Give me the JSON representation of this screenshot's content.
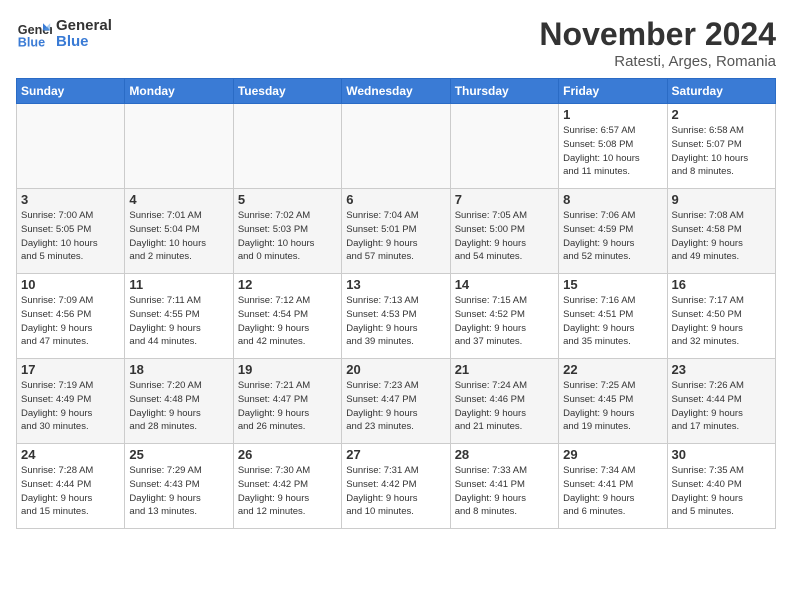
{
  "logo": {
    "line1": "General",
    "line2": "Blue"
  },
  "title": "November 2024",
  "subtitle": "Ratesti, Arges, Romania",
  "days_of_week": [
    "Sunday",
    "Monday",
    "Tuesday",
    "Wednesday",
    "Thursday",
    "Friday",
    "Saturday"
  ],
  "weeks": [
    [
      {
        "day": "",
        "info": ""
      },
      {
        "day": "",
        "info": ""
      },
      {
        "day": "",
        "info": ""
      },
      {
        "day": "",
        "info": ""
      },
      {
        "day": "",
        "info": ""
      },
      {
        "day": "1",
        "info": "Sunrise: 6:57 AM\nSunset: 5:08 PM\nDaylight: 10 hours\nand 11 minutes."
      },
      {
        "day": "2",
        "info": "Sunrise: 6:58 AM\nSunset: 5:07 PM\nDaylight: 10 hours\nand 8 minutes."
      }
    ],
    [
      {
        "day": "3",
        "info": "Sunrise: 7:00 AM\nSunset: 5:05 PM\nDaylight: 10 hours\nand 5 minutes."
      },
      {
        "day": "4",
        "info": "Sunrise: 7:01 AM\nSunset: 5:04 PM\nDaylight: 10 hours\nand 2 minutes."
      },
      {
        "day": "5",
        "info": "Sunrise: 7:02 AM\nSunset: 5:03 PM\nDaylight: 10 hours\nand 0 minutes."
      },
      {
        "day": "6",
        "info": "Sunrise: 7:04 AM\nSunset: 5:01 PM\nDaylight: 9 hours\nand 57 minutes."
      },
      {
        "day": "7",
        "info": "Sunrise: 7:05 AM\nSunset: 5:00 PM\nDaylight: 9 hours\nand 54 minutes."
      },
      {
        "day": "8",
        "info": "Sunrise: 7:06 AM\nSunset: 4:59 PM\nDaylight: 9 hours\nand 52 minutes."
      },
      {
        "day": "9",
        "info": "Sunrise: 7:08 AM\nSunset: 4:58 PM\nDaylight: 9 hours\nand 49 minutes."
      }
    ],
    [
      {
        "day": "10",
        "info": "Sunrise: 7:09 AM\nSunset: 4:56 PM\nDaylight: 9 hours\nand 47 minutes."
      },
      {
        "day": "11",
        "info": "Sunrise: 7:11 AM\nSunset: 4:55 PM\nDaylight: 9 hours\nand 44 minutes."
      },
      {
        "day": "12",
        "info": "Sunrise: 7:12 AM\nSunset: 4:54 PM\nDaylight: 9 hours\nand 42 minutes."
      },
      {
        "day": "13",
        "info": "Sunrise: 7:13 AM\nSunset: 4:53 PM\nDaylight: 9 hours\nand 39 minutes."
      },
      {
        "day": "14",
        "info": "Sunrise: 7:15 AM\nSunset: 4:52 PM\nDaylight: 9 hours\nand 37 minutes."
      },
      {
        "day": "15",
        "info": "Sunrise: 7:16 AM\nSunset: 4:51 PM\nDaylight: 9 hours\nand 35 minutes."
      },
      {
        "day": "16",
        "info": "Sunrise: 7:17 AM\nSunset: 4:50 PM\nDaylight: 9 hours\nand 32 minutes."
      }
    ],
    [
      {
        "day": "17",
        "info": "Sunrise: 7:19 AM\nSunset: 4:49 PM\nDaylight: 9 hours\nand 30 minutes."
      },
      {
        "day": "18",
        "info": "Sunrise: 7:20 AM\nSunset: 4:48 PM\nDaylight: 9 hours\nand 28 minutes."
      },
      {
        "day": "19",
        "info": "Sunrise: 7:21 AM\nSunset: 4:47 PM\nDaylight: 9 hours\nand 26 minutes."
      },
      {
        "day": "20",
        "info": "Sunrise: 7:23 AM\nSunset: 4:47 PM\nDaylight: 9 hours\nand 23 minutes."
      },
      {
        "day": "21",
        "info": "Sunrise: 7:24 AM\nSunset: 4:46 PM\nDaylight: 9 hours\nand 21 minutes."
      },
      {
        "day": "22",
        "info": "Sunrise: 7:25 AM\nSunset: 4:45 PM\nDaylight: 9 hours\nand 19 minutes."
      },
      {
        "day": "23",
        "info": "Sunrise: 7:26 AM\nSunset: 4:44 PM\nDaylight: 9 hours\nand 17 minutes."
      }
    ],
    [
      {
        "day": "24",
        "info": "Sunrise: 7:28 AM\nSunset: 4:44 PM\nDaylight: 9 hours\nand 15 minutes."
      },
      {
        "day": "25",
        "info": "Sunrise: 7:29 AM\nSunset: 4:43 PM\nDaylight: 9 hours\nand 13 minutes."
      },
      {
        "day": "26",
        "info": "Sunrise: 7:30 AM\nSunset: 4:42 PM\nDaylight: 9 hours\nand 12 minutes."
      },
      {
        "day": "27",
        "info": "Sunrise: 7:31 AM\nSunset: 4:42 PM\nDaylight: 9 hours\nand 10 minutes."
      },
      {
        "day": "28",
        "info": "Sunrise: 7:33 AM\nSunset: 4:41 PM\nDaylight: 9 hours\nand 8 minutes."
      },
      {
        "day": "29",
        "info": "Sunrise: 7:34 AM\nSunset: 4:41 PM\nDaylight: 9 hours\nand 6 minutes."
      },
      {
        "day": "30",
        "info": "Sunrise: 7:35 AM\nSunset: 4:40 PM\nDaylight: 9 hours\nand 5 minutes."
      }
    ]
  ]
}
